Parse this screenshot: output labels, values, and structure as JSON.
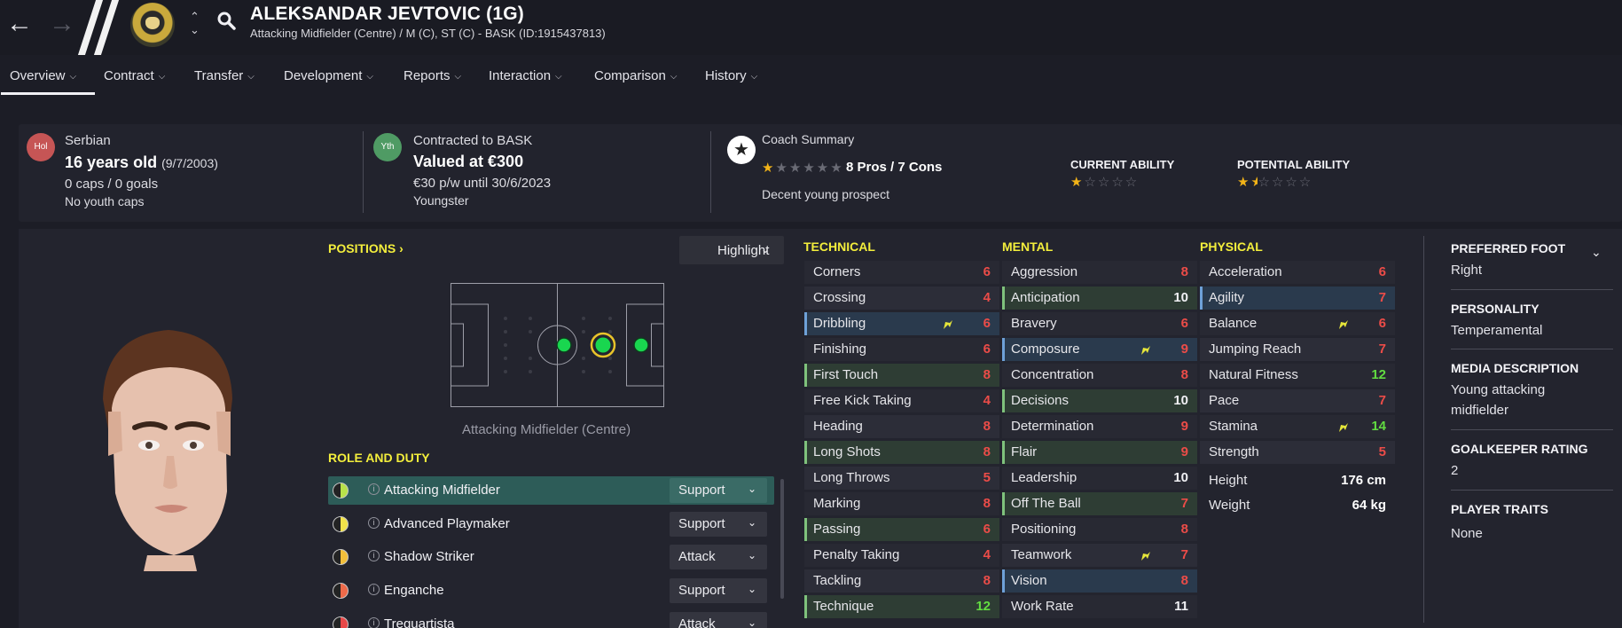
{
  "header": {
    "name": "ALEKSANDAR JEVTOVIC (1G)",
    "subtitle": "Attacking Midfielder (Centre) / M (C), ST (C) - BASK (ID:1915437813)"
  },
  "tabs": [
    {
      "label": "Overview"
    },
    {
      "label": "Contract"
    },
    {
      "label": "Transfer"
    },
    {
      "label": "Development"
    },
    {
      "label": "Reports"
    },
    {
      "label": "Interaction"
    },
    {
      "label": "Comparison"
    },
    {
      "label": "History"
    }
  ],
  "summary": {
    "nationality_badge": "Hol",
    "nationality": "Serbian",
    "age": "16 years old",
    "dob": "(9/7/2003)",
    "caps": "0 caps / 0 goals",
    "youth_caps": "No youth caps",
    "status_badge": "Yth",
    "contract": "Contracted to BASK",
    "value": "Valued at €300",
    "wage": "€30 p/w until 30/6/2023",
    "squad_status": "Youngster",
    "coach_title": "Coach Summary",
    "coach_stars": 1,
    "pros_cons": "8 Pros / 7 Cons",
    "coach_comment": "Decent young prospect",
    "current_ability_label": "CURRENT ABILITY",
    "current_ability_stars": 1,
    "potential_ability_label": "POTENTIAL ABILITY",
    "potential_ability_stars": 1.5
  },
  "positions": {
    "title": "POSITIONS",
    "highlight_label": "Highlight",
    "caption": "Attacking Midfielder (Centre)"
  },
  "roles": {
    "title": "ROLE AND DUTY",
    "items": [
      {
        "name": "Attacking Midfielder",
        "duty": "Support"
      },
      {
        "name": "Advanced Playmaker",
        "duty": "Support"
      },
      {
        "name": "Shadow Striker",
        "duty": "Attack"
      },
      {
        "name": "Enganche",
        "duty": "Support"
      },
      {
        "name": "Trequartista",
        "duty": "Attack"
      }
    ]
  },
  "technical": {
    "title": "TECHNICAL",
    "attrs": [
      {
        "name": "Corners",
        "value": 6
      },
      {
        "name": "Crossing",
        "value": 4
      },
      {
        "name": "Dribbling",
        "value": 6
      },
      {
        "name": "Finishing",
        "value": 6
      },
      {
        "name": "First Touch",
        "value": 8
      },
      {
        "name": "Free Kick Taking",
        "value": 4
      },
      {
        "name": "Heading",
        "value": 8
      },
      {
        "name": "Long Shots",
        "value": 8
      },
      {
        "name": "Long Throws",
        "value": 5
      },
      {
        "name": "Marking",
        "value": 8
      },
      {
        "name": "Passing",
        "value": 6
      },
      {
        "name": "Penalty Taking",
        "value": 4
      },
      {
        "name": "Tackling",
        "value": 8
      },
      {
        "name": "Technique",
        "value": 12
      }
    ]
  },
  "mental": {
    "title": "MENTAL",
    "attrs": [
      {
        "name": "Aggression",
        "value": 8
      },
      {
        "name": "Anticipation",
        "value": 10
      },
      {
        "name": "Bravery",
        "value": 6
      },
      {
        "name": "Composure",
        "value": 9
      },
      {
        "name": "Concentration",
        "value": 8
      },
      {
        "name": "Decisions",
        "value": 10
      },
      {
        "name": "Determination",
        "value": 9
      },
      {
        "name": "Flair",
        "value": 9
      },
      {
        "name": "Leadership",
        "value": 10
      },
      {
        "name": "Off The Ball",
        "value": 7
      },
      {
        "name": "Positioning",
        "value": 8
      },
      {
        "name": "Teamwork",
        "value": 7
      },
      {
        "name": "Vision",
        "value": 8
      },
      {
        "name": "Work Rate",
        "value": 11
      }
    ]
  },
  "physical": {
    "title": "PHYSICAL",
    "attrs": [
      {
        "name": "Acceleration",
        "value": 6
      },
      {
        "name": "Agility",
        "value": 7
      },
      {
        "name": "Balance",
        "value": 6
      },
      {
        "name": "Jumping Reach",
        "value": 7
      },
      {
        "name": "Natural Fitness",
        "value": 12
      },
      {
        "name": "Pace",
        "value": 7
      },
      {
        "name": "Stamina",
        "value": 14
      },
      {
        "name": "Strength",
        "value": 5
      }
    ],
    "height_label": "Height",
    "height": "176 cm",
    "weight_label": "Weight",
    "weight": "64 kg"
  },
  "sidebar": {
    "preferred_foot_label": "PREFERRED FOOT",
    "preferred_foot": "Right",
    "personality_label": "PERSONALITY",
    "personality": "Temperamental",
    "media_label": "MEDIA DESCRIPTION",
    "media": "Young attacking midfielder",
    "gk_label": "GOALKEEPER RATING",
    "gk": "2",
    "traits_label": "PLAYER TRAITS",
    "traits": "None"
  },
  "colors": {
    "accent_yellow": "#f3ee3c",
    "value_red": "#ec4c48",
    "value_green": "#62dc41",
    "highlight_green_bar": "#7fc27c",
    "highlight_blue_bar": "#6ea1d8",
    "active_role": "#2d5c58"
  }
}
